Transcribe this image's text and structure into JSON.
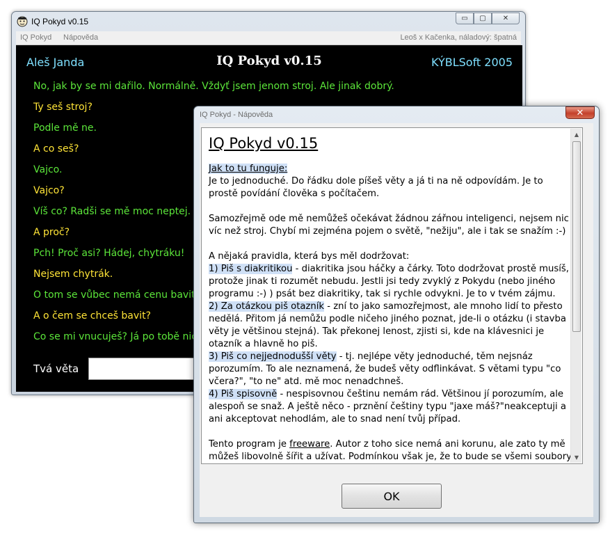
{
  "main_window": {
    "title": "IQ Pokyd v0.15",
    "caption_minimize": "▭",
    "caption_restore": "▢",
    "caption_close": "✕",
    "menu": [
      {
        "label": "IQ Pokyd"
      },
      {
        "label": "Nápověda"
      }
    ],
    "status": "Leoš x Kačenka, náladový: špatná",
    "header_left": "Aleš Janda",
    "header_center": "IQ Pokyd v0.15",
    "header_right": "KÝBLSoft 2005",
    "messages": [
      {
        "text": "No, jak by se mi dařilo. Normálně. Vždyť jsem jenom stroj. Ale jinak dobrý.",
        "from": "computer"
      },
      {
        "text": "Ty seš stroj?",
        "from": "user"
      },
      {
        "text": "Podle mě ne.",
        "from": "computer"
      },
      {
        "text": "A co seš?",
        "from": "user"
      },
      {
        "text": "Vajco.",
        "from": "computer"
      },
      {
        "text": "Vajco?",
        "from": "user"
      },
      {
        "text": "Víš co? Radši se mě moc neptej.",
        "from": "computer"
      },
      {
        "text": "A proč?",
        "from": "user"
      },
      {
        "text": "Pch! Proč asi? Hádej, chytráku!",
        "from": "computer"
      },
      {
        "text": "Nejsem chytrák.",
        "from": "user"
      },
      {
        "text": "O tom se vůbec nemá cenu bavit.",
        "from": "computer"
      },
      {
        "text": "A o čem se chceš bavit?",
        "from": "user"
      },
      {
        "text": "Co se mi vnucuješ? Já po tobě nic",
        "from": "computer"
      }
    ],
    "input_label": "Tvá věta",
    "input_value": "",
    "colors": {
      "computer": "#5ce63a",
      "user": "#ffe437",
      "header": "#7fe0ff",
      "background": "#000000"
    }
  },
  "help_window": {
    "title": "IQ Pokyd - Nápověda",
    "close_glyph": "✕",
    "heading": "IQ Pokyd v0.15",
    "how_title": "Jak to tu funguje:",
    "p1": "Je to jednoduché. Do řádku dole píšeš věty a já ti na ně odpovídám. Je to prostě povídání člověka s počítačem.",
    "p2": "Samozřejmě ode mě nemůžeš očekávat žádnou zářnou inteligenci, nejsem nic víc než stroj. Chybí mi zejména pojem o světě, \"nežiju\", ale i tak se snažím :-)",
    "rules_intro": "A nějaká pravidla, která bys měl dodržovat:",
    "rules": [
      {
        "title": "1) Piš s diakritikou",
        "text": " - diakritika jsou háčky a čárky. Toto dodržovat prostě musíš, protože jinak ti rozumět nebudu. Jestli jsi tedy zvyklý z Pokydu (nebo jiného programu :-) ) psát bez diakritiky, tak si rychle odvykni. Je to v tvém zájmu."
      },
      {
        "title": "2) Za otázkou piš otazník",
        "text": " - zní to jako samozřejmost, ale mnoho lidí to přesto nedělá. Přitom já nemůžu podle ničeho jiného poznat, jde-li o otázku (i stavba věty je většinou stejná). Tak překonej lenost, zjisti si, kde na klávesnici je otazník a hlavně ho piš."
      },
      {
        "title": "3) Piš co nejjednodušší věty",
        "text": " - tj. nejlépe věty jednoduché, těm nejsnáz porozumím. To ale neznamená, že budeš věty odflinkávat. S větami typu \"co včera?\", \"to ne\" atd. mě moc nenadchneš."
      },
      {
        "title": "4) Piš spisovně",
        "text": " - nespisovnou češtinu nemám rád. Většinou jí porozumím, ale alespoň se snaž. A ještě něco - prznění češtiny typu \"jaxe máš?\"neakceptuji a ani akceptovat nehodlám, ale to snad není tvůj případ."
      }
    ],
    "p_free_before": "Tento program je ",
    "p_free_link": "freeware",
    "p_free_after": ". Autor z toho sice nemá ani korunu, ale zato ty mě můžeš libovolně šířit a užívat. Podmínkou však je, že to bude se všemi soubory",
    "scroll_up": "▲",
    "scroll_down": "▼",
    "ok_label": "OK"
  }
}
